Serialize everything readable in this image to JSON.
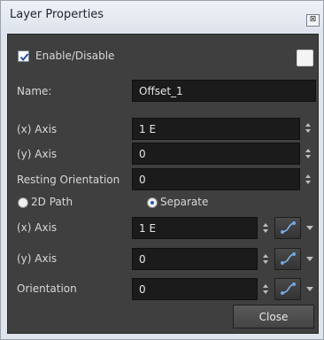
{
  "window": {
    "title": "Layer Properties",
    "close_glyph": "⊠"
  },
  "enable": {
    "label": "Enable/Disable",
    "checked": true
  },
  "name": {
    "label": "Name:",
    "value": "Offset_1"
  },
  "position": {
    "x_label": "(x) Axis",
    "x_value": "1 E",
    "y_label": "(y) Axis",
    "y_value": "0",
    "resting_label": "Resting Orientation",
    "resting_value": "0"
  },
  "path_mode": {
    "option_2d": "2D Path",
    "option_separate": "Separate",
    "selected": "Separate"
  },
  "separate": {
    "x_label": "(x) Axis",
    "x_value": "1 E",
    "y_label": "(y) Axis",
    "y_value": "0",
    "orientation_label": "Orientation",
    "orientation_value": "0"
  },
  "buttons": {
    "close": "Close"
  },
  "colors": {
    "panel": "#3f3f3f",
    "field": "#1b1b1b",
    "accent": "#1f5fbf"
  }
}
